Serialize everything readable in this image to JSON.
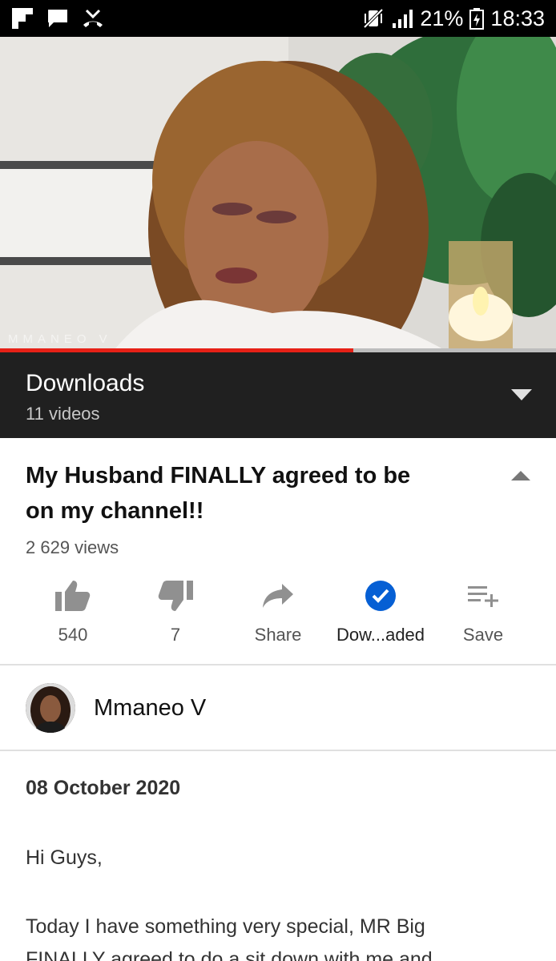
{
  "status_bar": {
    "battery": "21%",
    "time": "18:33",
    "icons": [
      "flipboard-icon",
      "message-icon",
      "missed-call-icon",
      "vibrate-icon",
      "signal-icon",
      "battery-icon"
    ]
  },
  "video": {
    "watermark": "MMANEO V",
    "progress": 0.635,
    "progress_color": "#e62117"
  },
  "downloads": {
    "title": "Downloads",
    "count": "11 videos"
  },
  "video_info": {
    "title_line1": "My Husband FINALLY agreed to be",
    "title_line2": "on my channel!!",
    "views": "2 629 views"
  },
  "actions": {
    "like": "540",
    "dislike": "7",
    "share": "Share",
    "download": "Dow...aded",
    "save": "Save"
  },
  "channel": {
    "name": "Mmaneo V"
  },
  "description": {
    "date": "08 October 2020",
    "greeting": "Hi Guys,",
    "line1": "Today I have something very special, MR Big",
    "line2": "FINALLY agreed to do a sit down with me and"
  },
  "colors": {
    "accent_blue": "#065fd4",
    "dark_bar": "#202020"
  }
}
